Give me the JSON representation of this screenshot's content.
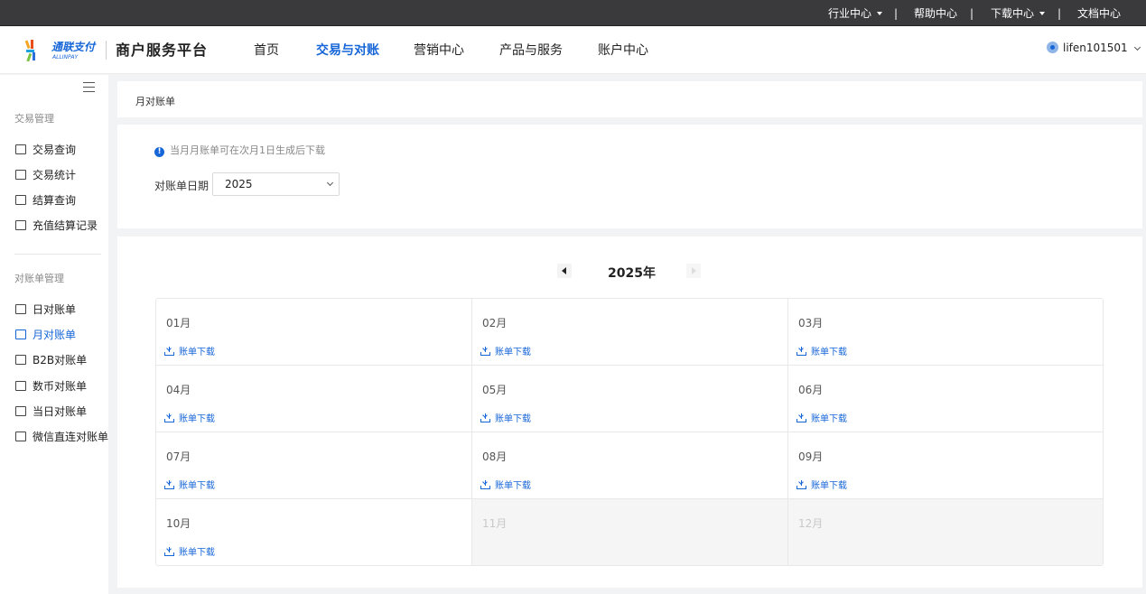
{
  "topbar": {
    "items": [
      {
        "label": "行业中心",
        "has_dropdown": true
      },
      {
        "label": "帮助中心",
        "has_dropdown": false
      },
      {
        "label": "下载中心",
        "has_dropdown": true
      },
      {
        "label": "文档中心",
        "has_dropdown": false
      }
    ],
    "separator": "|"
  },
  "header": {
    "logo_text": "通联支付",
    "logo_subtext": "ALLINPAY",
    "platform_title": "商户服务平台",
    "nav": [
      {
        "label": "首页",
        "active": false
      },
      {
        "label": "交易与对账",
        "active": true
      },
      {
        "label": "营销中心",
        "active": false
      },
      {
        "label": "产品与服务",
        "active": false
      },
      {
        "label": "账户中心",
        "active": false
      }
    ],
    "username": "lifen101501"
  },
  "sidebar": {
    "groups": [
      {
        "title": "交易管理",
        "items": [
          {
            "label": "交易查询",
            "icon": "calendar-icon",
            "active": false
          },
          {
            "label": "交易统计",
            "icon": "chart-icon",
            "active": false
          },
          {
            "label": "结算查询",
            "icon": "card-icon",
            "active": false
          },
          {
            "label": "充值结算记录",
            "icon": "clipboard-icon",
            "active": false
          }
        ]
      },
      {
        "title": "对账单管理",
        "items": [
          {
            "label": "日对账单",
            "icon": "day-bill-icon",
            "active": false
          },
          {
            "label": "月对账单",
            "icon": "wallet-icon",
            "active": true
          },
          {
            "label": "B2B对账单",
            "icon": "bar-chart-icon",
            "active": false
          },
          {
            "label": "数币对账单",
            "icon": "exchange-icon",
            "active": false
          },
          {
            "label": "当日对账单",
            "icon": "today-icon",
            "active": false
          },
          {
            "label": "微信直连对账单",
            "icon": "wechat-bill-icon",
            "active": false
          }
        ]
      }
    ]
  },
  "breadcrumb": {
    "current": "月对账单"
  },
  "filter": {
    "notice": "当月月账单可在次月1日生成后下载",
    "date_label": "对账单日期",
    "year_value": "2025"
  },
  "calendar": {
    "year_title": "2025年",
    "download_label": "账单下载",
    "months": [
      {
        "label": "01月",
        "available": true
      },
      {
        "label": "02月",
        "available": true
      },
      {
        "label": "03月",
        "available": true
      },
      {
        "label": "04月",
        "available": true
      },
      {
        "label": "05月",
        "available": true
      },
      {
        "label": "06月",
        "available": true
      },
      {
        "label": "07月",
        "available": true
      },
      {
        "label": "08月",
        "available": true
      },
      {
        "label": "09月",
        "available": true
      },
      {
        "label": "10月",
        "available": true
      },
      {
        "label": "11月",
        "available": false
      },
      {
        "label": "12月",
        "available": false
      }
    ]
  },
  "colors": {
    "accent": "#1766d8",
    "topbar_bg": "#3a3a3c",
    "page_bg": "#f2f3f5"
  }
}
